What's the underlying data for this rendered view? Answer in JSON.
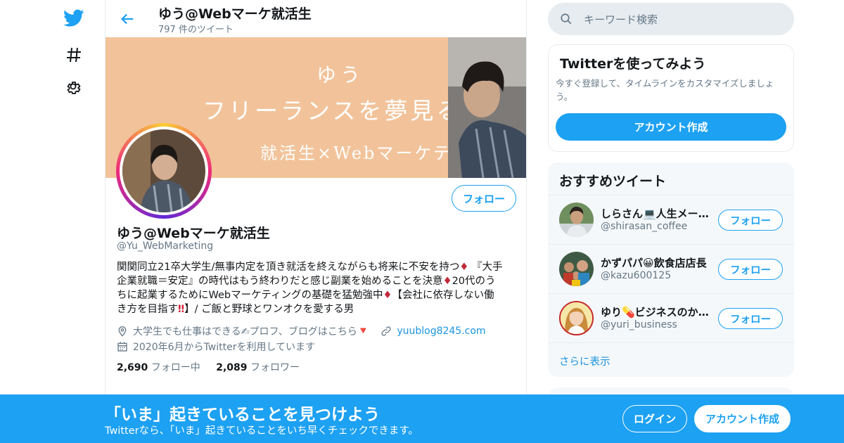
{
  "header": {
    "title": "ゆう@Webマーケ就活生",
    "tweet_count": "797 件のツイート"
  },
  "banner": {
    "line1": "ゆう",
    "line2": "フリーランスを夢見る",
    "line3": "就活生×Webマーケティング"
  },
  "profile": {
    "follow_label": "フォロー",
    "name": "ゆう@Webマーケ就活生",
    "handle": "@Yu_WebMarketing",
    "bio": {
      "l1a": "関関同立21卒大学生/無事内定を頂き就活を終えながらも将来に不安を持つ",
      "l1b": "『大手",
      "l2a": "企業就職＝安定』の時代はもう終わりだと感じ副業を始めることを決意",
      "l2b": "20代のう",
      "l3a": "ちに起業するためにWebマーケティングの基礎を猛勉強中",
      "l3b": "【会社に依存しない働",
      "l4a": "き方を目指す",
      "l4b": "】/ ご飯と野球とワンオクを愛する男",
      "diamond": "♦",
      "exclaim": "‼"
    },
    "location": "大学生でも仕事はできる✍プロフ、ブログはこちら",
    "location_tri": "🔻",
    "website": "yuublog8245.com",
    "joined": "2020年6月からTwitterを利用しています",
    "following_count": "2,690",
    "following_label": "フォロー中",
    "followers_count": "2,089",
    "followers_label": "フォロワー"
  },
  "search": {
    "placeholder": "キーワード検索"
  },
  "signup_card": {
    "title": "Twitterを使ってみよう",
    "description": "今すぐ登録して、タイムラインをカスタマイズしましょう。",
    "button": "アカウント作成"
  },
  "recommend": {
    "title": "おすすめツイート",
    "items": [
      {
        "name": "しらさん💻人生メーカー",
        "handle": "@shirasan_coffee",
        "follow": "フォロー"
      },
      {
        "name": "かずパパ😀飲食店店長",
        "handle": "@kazu600125",
        "follow": "フォロー"
      },
      {
        "name": "ゆり💊ビジネスのかなめ",
        "handle": "@yuri_business",
        "follow": "フォロー"
      }
    ],
    "show_more": "さらに表示"
  },
  "bottom_bar": {
    "title": "「いま」起きていることを見つけよう",
    "subtitle": "Twitterなら、「いま」起きていることをいち早くチェックできます。",
    "login": "ログイン",
    "signup": "アカウント作成"
  },
  "colors": {
    "accent": "#1da1f2",
    "banner_bg": "#f2c39a",
    "secondary_text": "#657786"
  },
  "icons": [
    "twitter-logo-icon",
    "hashtag-icon",
    "settings-gear-icon",
    "back-arrow-icon",
    "search-icon",
    "location-icon",
    "link-icon",
    "calendar-icon"
  ]
}
